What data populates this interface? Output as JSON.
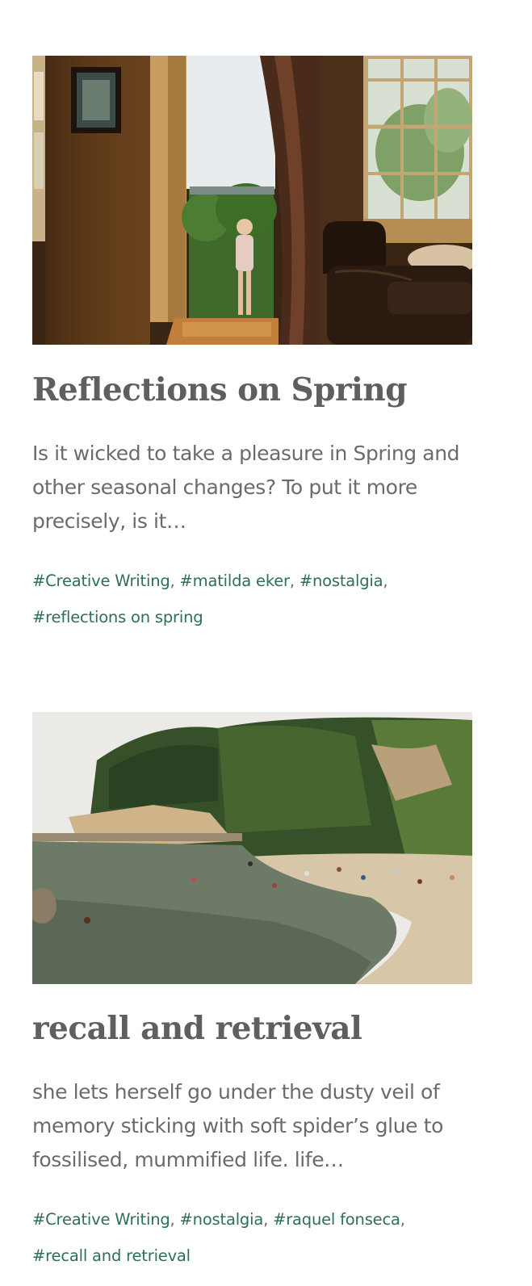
{
  "posts": [
    {
      "image_alt": "Child standing in a sunlit doorway of a room with curtains, window and leather chair",
      "title": "Reflections on Spring",
      "excerpt": "Is it wicked to take a pleasure in Spring and other seasonal changes? To put it more precisely, is it…",
      "tags": [
        "#Creative Writing",
        "#matilda eker",
        "#nostalgia",
        "#reflections on spring"
      ],
      "separator": ","
    },
    {
      "image_alt": "Rocky beach cove with swimmers and sunbathers beneath a wooded cliff",
      "title": "recall and retrieval",
      "excerpt": "she lets herself go under the dusty veil of memory sticking with soft spider’s glue to fossilised, mummified life. life…",
      "tags": [
        "#Creative Writing",
        "#nostalgia",
        "#raquel fonseca",
        "#recall and retrieval"
      ],
      "separator": ","
    }
  ],
  "colors": {
    "title": "#5f5f5f",
    "text": "#6b6b6b",
    "tag_link": "#2f6e58"
  }
}
